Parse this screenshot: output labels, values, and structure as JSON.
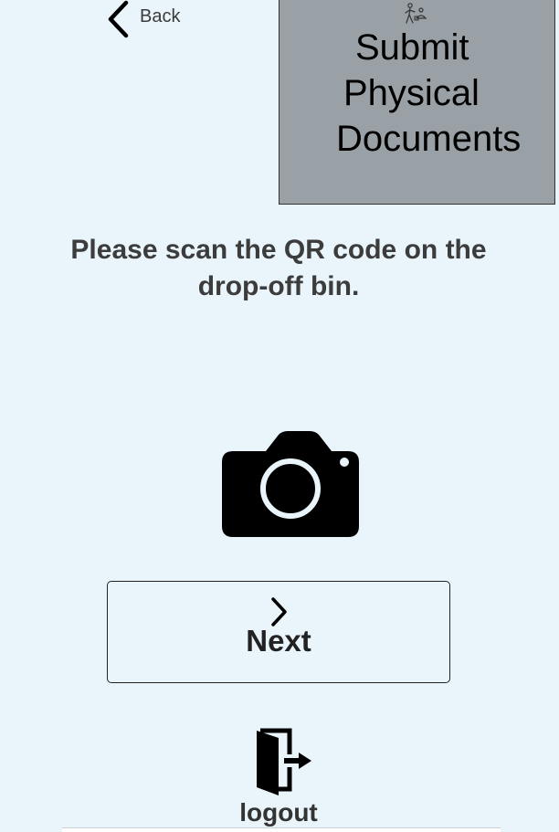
{
  "nav": {
    "back_label": "Back",
    "back_icon": "chevron-left-icon"
  },
  "header": {
    "title_line1": "Submit",
    "title_line2": "Physical",
    "title_line3": "Documents",
    "title_icon": "person-dropping-box-icon",
    "box_color": "#9aa1a6"
  },
  "main": {
    "instruction": "Please scan the QR code on the drop-off bin.",
    "camera_icon": "camera-icon"
  },
  "actions": {
    "next_label": "Next",
    "next_icon": "chevron-right-icon",
    "logout_label": "logout",
    "logout_icon": "logout-door-icon"
  },
  "colors": {
    "background": "#e9f4fb",
    "text": "#3c3c3c"
  }
}
